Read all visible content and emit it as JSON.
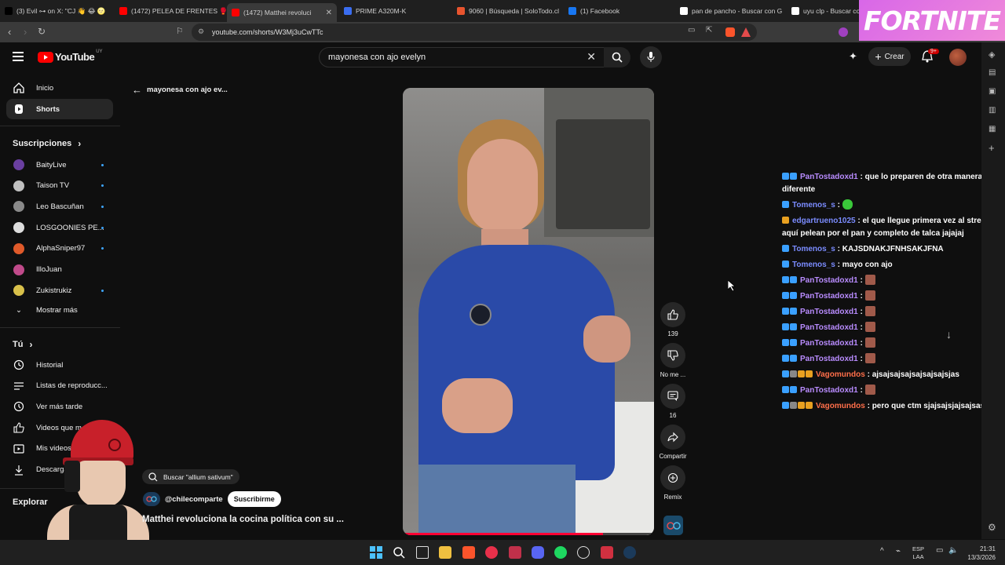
{
  "browser": {
    "tabs": [
      {
        "title": "(3) Evil ⊶ on X: \"CJ 👋 😂 🌝",
        "favicon_color": "#000000",
        "active": false
      },
      {
        "title": "(1472) PELEA DE FRENTES 🥊",
        "favicon_color": "#ff0000",
        "active": false
      },
      {
        "title": "(1472) Matthei revoluci",
        "favicon_color": "#ff0000",
        "active": true
      },
      {
        "title": "PRIME A320M-K",
        "favicon_color": "#3a6df0",
        "active": false
      },
      {
        "title": "9060 | Búsqueda | SoloTodo.cl",
        "favicon_color": "#e8542e",
        "active": false
      },
      {
        "title": "(1) Facebook",
        "favicon_color": "#1877f2",
        "active": false
      },
      {
        "title": "pan de pancho - Buscar con G",
        "favicon_color": "#ffffff",
        "active": false
      },
      {
        "title": "uyu clp - Buscar con",
        "favicon_color": "#ffffff",
        "active": false
      }
    ],
    "url": "youtube.com/shorts/W3Mj3uCwTTc"
  },
  "ad": {
    "text": "FORTNITE"
  },
  "header": {
    "logo_text": "YouTube",
    "country": "UY",
    "search_value": "mayonesa con ajo evelyn",
    "create_label": "Crear",
    "notif_count": "9+"
  },
  "sidebar": {
    "main": [
      {
        "label": "Inicio",
        "icon": "home-icon"
      },
      {
        "label": "Shorts",
        "icon": "shorts-icon"
      }
    ],
    "subs_header": "Suscripciones",
    "subscriptions": [
      {
        "label": "BaityLive",
        "color": "#6a3fa0"
      },
      {
        "label": "Taison TV",
        "color": "#c0c0c0"
      },
      {
        "label": "Leo Bascuñan",
        "color": "#8a8a8a"
      },
      {
        "label": "LOSGOONIES PE...",
        "color": "#dddddd"
      },
      {
        "label": "AlphaSniper97",
        "color": "#e05a2a"
      },
      {
        "label": "IlloJuan",
        "color": "#c04a8a"
      },
      {
        "label": "Zukistrukiz",
        "color": "#d8c04a"
      }
    ],
    "show_more": "Mostrar más",
    "you_header": "Tú",
    "you_items": [
      {
        "label": "Historial",
        "icon": "history-icon"
      },
      {
        "label": "Listas de reproducc...",
        "icon": "playlist-icon"
      },
      {
        "label": "Ver más tarde",
        "icon": "clock-icon"
      },
      {
        "label": "Videos que m",
        "icon": "like-icon"
      },
      {
        "label": "Mis videos",
        "icon": "video-icon"
      },
      {
        "label": "Descargas",
        "icon": "download-icon"
      }
    ],
    "explore_header": "Explorar"
  },
  "shorts": {
    "back_title": "mayonesa con ajo ev...",
    "search_chip": "Buscar \"allium sativum\"",
    "channel": "@chilecomparte",
    "subscribe": "Suscribirme",
    "title": "Matthei revoluciona la cocina política con su ...",
    "like_count": "139",
    "dislike_label": "No me ...",
    "comments_count": "16",
    "share_label": "Compartir",
    "remix_label": "Remix"
  },
  "chat": [
    {
      "user": "PanTostadoxd1",
      "color_class": "",
      "badges": [
        "#3aa0ff",
        "#3aa0ff"
      ],
      "text": "que lo preparen de otra manera es diferente"
    },
    {
      "user": "Tomenos_s",
      "color_class": "blue",
      "badges": [
        "#3aa0ff"
      ],
      "text": "",
      "emote": "green"
    },
    {
      "user": "edgartrueno1025",
      "color_class": "blue",
      "badges": [
        "#e8a020"
      ],
      "text": "el que llegue primera vez al stream , aquí pelean por el pan y completo de talca jajajaj"
    },
    {
      "user": "Tomenos_s",
      "color_class": "blue",
      "badges": [
        "#3aa0ff"
      ],
      "text": "KAJSDNAKJFNHSAKJFNA"
    },
    {
      "user": "Tomenos_s",
      "color_class": "blue",
      "badges": [
        "#3aa0ff"
      ],
      "text": "mayo con ajo"
    },
    {
      "user": "PanTostadoxd1",
      "color_class": "",
      "badges": [
        "#3aa0ff",
        "#3aa0ff"
      ],
      "text": "",
      "emote": "face"
    },
    {
      "user": "PanTostadoxd1",
      "color_class": "",
      "badges": [
        "#3aa0ff",
        "#3aa0ff"
      ],
      "text": "",
      "emote": "face"
    },
    {
      "user": "PanTostadoxd1",
      "color_class": "",
      "badges": [
        "#3aa0ff",
        "#3aa0ff"
      ],
      "text": "",
      "emote": "face"
    },
    {
      "user": "PanTostadoxd1",
      "color_class": "",
      "badges": [
        "#3aa0ff",
        "#3aa0ff"
      ],
      "text": "",
      "emote": "face"
    },
    {
      "user": "PanTostadoxd1",
      "color_class": "",
      "badges": [
        "#3aa0ff",
        "#3aa0ff"
      ],
      "text": "",
      "emote": "face"
    },
    {
      "user": "PanTostadoxd1",
      "color_class": "",
      "badges": [
        "#3aa0ff",
        "#3aa0ff"
      ],
      "text": "",
      "emote": "face"
    },
    {
      "user": "Vagomundos",
      "color_class": "orange",
      "badges": [
        "#3aa0ff",
        "#888888",
        "#e8a020",
        "#e8a020"
      ],
      "text": "ajsajsajsajsajsajsajsjas"
    },
    {
      "user": "PanTostadoxd1",
      "color_class": "",
      "badges": [
        "#3aa0ff",
        "#3aa0ff"
      ],
      "text": "",
      "emote": "face"
    },
    {
      "user": "Vagomundos",
      "color_class": "orange",
      "badges": [
        "#3aa0ff",
        "#888888",
        "#e8a020",
        "#e8a020"
      ],
      "text": "pero que ctm sjajsajsjajsajsas"
    }
  ],
  "taskbar": {
    "lang": "ESP",
    "lang2": "LAA",
    "time": "21:31",
    "date": "13/3/2026"
  }
}
